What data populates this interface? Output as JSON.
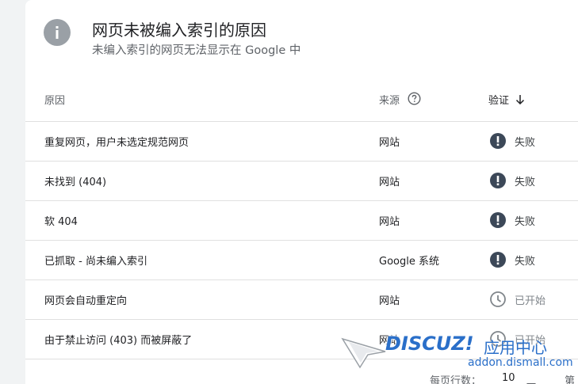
{
  "header": {
    "icon": "info-icon",
    "title": "网页未被编入索引的原因",
    "subtitle": "未编入索引的网页无法显示在 Google 中"
  },
  "table": {
    "columns": {
      "reason": "原因",
      "source": "来源",
      "validation": "验证"
    },
    "rows": [
      {
        "reason": "重复网页，用户未选定规范网页",
        "source": "网站",
        "status": "失败",
        "status_icon": "error-icon"
      },
      {
        "reason": "未找到 (404)",
        "source": "网站",
        "status": "失败",
        "status_icon": "error-icon"
      },
      {
        "reason": "软 404",
        "source": "网站",
        "status": "失败",
        "status_icon": "error-icon"
      },
      {
        "reason": "已抓取 - 尚未编入索引",
        "source": "Google 系统",
        "status": "失败",
        "status_icon": "error-icon"
      },
      {
        "reason": "网页会自动重定向",
        "source": "网站",
        "status": "已开始",
        "status_icon": "clock-icon"
      },
      {
        "reason": "由于禁止访问 (403) 而被屏蔽了",
        "source": "网站",
        "status": "已开始",
        "status_icon": "clock-icon"
      }
    ]
  },
  "footer": {
    "rows_per_page_label": "每页行数：",
    "rows_per_page_value": "10",
    "page_label": "第"
  },
  "watermark": {
    "logo": "DISCUZ!",
    "cn": "应用中心",
    "url": "addon.dismall.com"
  },
  "colors": {
    "error": "#3c4858",
    "started": "#80868b",
    "watermark": "#2a6fc9"
  }
}
